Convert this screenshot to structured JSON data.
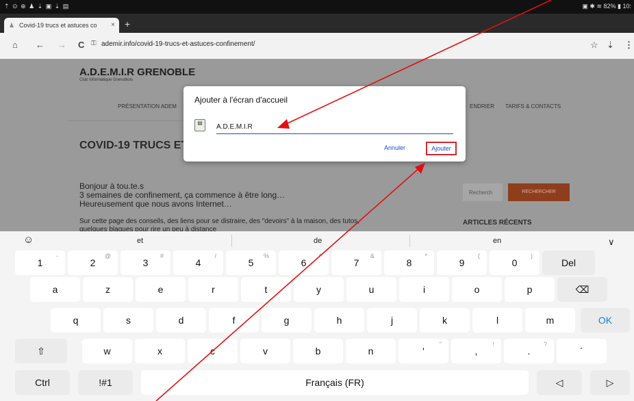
{
  "status_bar": {
    "left_icons": "⇡ ⊙ ⊕ ♟ ⇣ ▣ ⇣ ▤",
    "right": "▣ ✱ ≋ 82% ▮ 10:"
  },
  "tab": {
    "title": "Covid-19 trucs et astuces co",
    "close": "×",
    "new_tab": "+"
  },
  "toolbar": {
    "home": "⌂",
    "back": "←",
    "forward": "→",
    "reload": "C",
    "lock": "🔒",
    "url": "ademir.info/covid-19-trucs-et-astuces-confinement/",
    "star": "☆",
    "download": "⇣",
    "menu": "⋮"
  },
  "page": {
    "site_title": "A.D.E.M.I.R GRENOBLE",
    "site_subtitle": "Club Informatique Grenoblois",
    "nav": [
      "PRÉSENTATION ADEM",
      "ENDRIER",
      "TARIFS & CONTACTS"
    ],
    "hero_title": "COVID-19 TRUCS ET",
    "intro": [
      "Bonjour à tou.te.s",
      "3 semaines de confinement, ça commence à être long…",
      "Heureusement que nous avons Internet…"
    ],
    "body_line1": "Sur cette page des conseils, des liens pour se distraire, des \"devoirs\" à la maison, des tutos,",
    "body_line2": "quelques blagues pour rire un peu à distance",
    "search_placeholder": "Recherch",
    "search_button": "RECHERCHER",
    "recent_title": "ARTICLES RÉCENTS"
  },
  "dialog": {
    "title": "Ajouter à l'écran d'accueil",
    "input_value": "A.D.E.M.I.R",
    "cancel": "Annuler",
    "add": "Ajouter"
  },
  "keyboard": {
    "emoji": "☺",
    "suggestions": [
      "et",
      "de",
      "en"
    ],
    "collapse": "∨",
    "row1": [
      {
        "k": "1",
        "s": "-"
      },
      {
        "k": "2",
        "s": "@"
      },
      {
        "k": "3",
        "s": "#"
      },
      {
        "k": "4",
        "s": "/"
      },
      {
        "k": "5",
        "s": "%"
      },
      {
        "k": "6",
        "s": "^"
      },
      {
        "k": "7",
        "s": "&"
      },
      {
        "k": "8",
        "s": "*"
      },
      {
        "k": "9",
        "s": "("
      },
      {
        "k": "0",
        "s": ")"
      }
    ],
    "del": "Del",
    "row2": [
      "a",
      "z",
      "e",
      "r",
      "t",
      "y",
      "u",
      "i",
      "o",
      "p"
    ],
    "backspace": "⌫",
    "row3": [
      "q",
      "s",
      "d",
      "f",
      "g",
      "h",
      "j",
      "k",
      "l",
      "m"
    ],
    "ok": "OK",
    "shift": "⇧",
    "row4": [
      {
        "k": "w",
        "s": ""
      },
      {
        "k": "x",
        "s": ""
      },
      {
        "k": "c",
        "s": ""
      },
      {
        "k": "v",
        "s": ""
      },
      {
        "k": "b",
        "s": ""
      },
      {
        "k": "n",
        "s": ""
      },
      {
        "k": "'",
        "s": "\""
      },
      {
        "k": ",",
        "s": "!"
      },
      {
        "k": ".",
        "s": "?"
      },
      {
        "k": "´",
        "s": ""
      }
    ],
    "ctrl": "Ctrl",
    "sym": "!#1",
    "space": "Français (FR)",
    "left": "◁",
    "right": "▷"
  },
  "colors": {
    "accent": "#1a4fd1",
    "highlight": "#d3262f",
    "search_button": "#8e3e1d"
  }
}
